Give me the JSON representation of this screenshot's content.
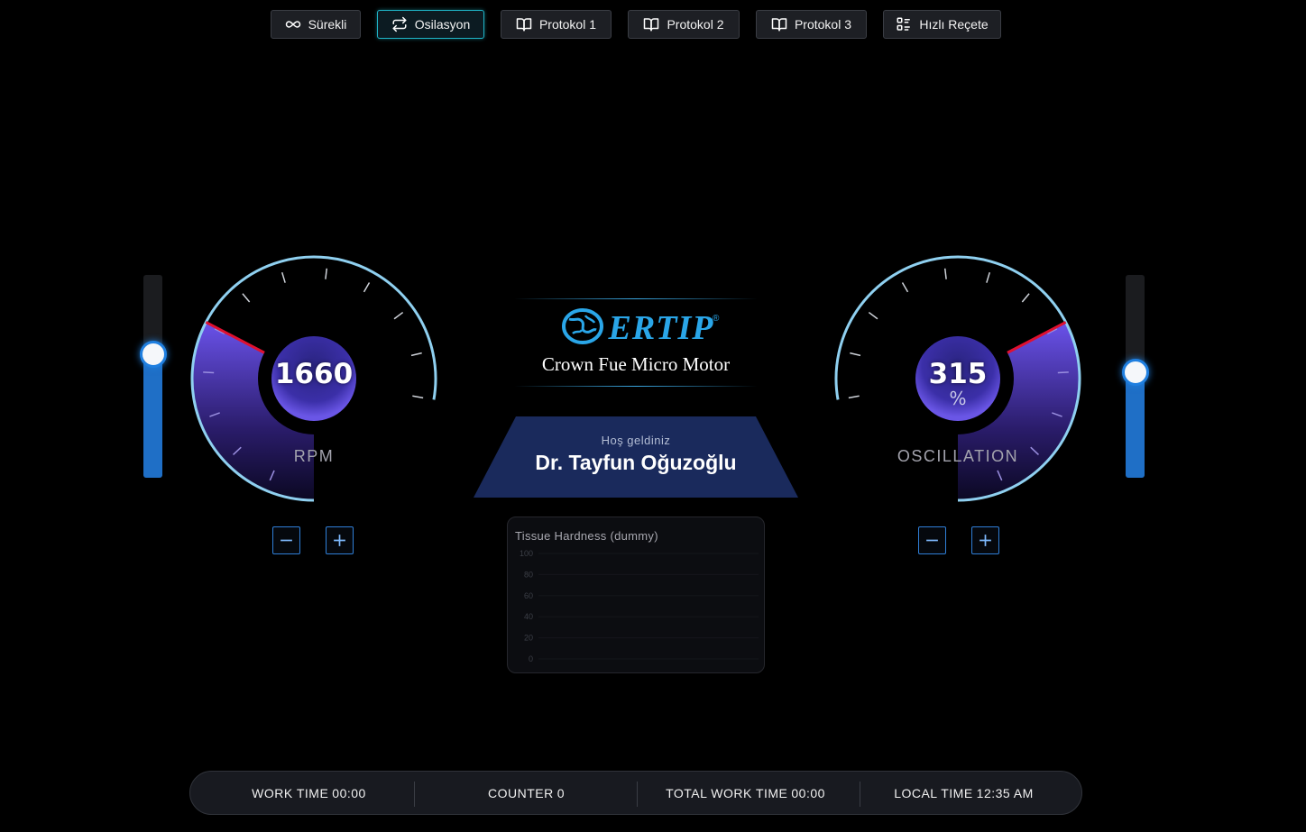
{
  "modes": [
    {
      "label": "Sürekli",
      "icon": "infinity-icon",
      "active": false
    },
    {
      "label": "Osilasyon",
      "icon": "repeat-icon",
      "active": true
    },
    {
      "label": "Protokol 1",
      "icon": "book-icon",
      "active": false
    },
    {
      "label": "Protokol 2",
      "icon": "book-icon",
      "active": false
    },
    {
      "label": "Protokol 3",
      "icon": "book-icon",
      "active": false
    },
    {
      "label": "Hızlı Reçete",
      "icon": "list-icon",
      "active": false
    }
  ],
  "rpm": {
    "value": "1660",
    "label": "RPM",
    "level": 0.42,
    "slider_level": 0.61
  },
  "oscillation": {
    "value": "315",
    "unit": "%",
    "label": "OSCILLATION",
    "level": 0.42,
    "slider_level": 0.52
  },
  "logo": {
    "brand": "ERTIP",
    "registered": "®",
    "subtitle": "Crown Fue Micro Motor"
  },
  "welcome": {
    "greeting": "Hoş geldiniz",
    "name": "Dr. Tayfun Oğuzoğlu"
  },
  "chart_data": {
    "type": "line",
    "title": "Tissue Hardness (dummy)",
    "xlabel": "",
    "ylabel": "",
    "ylim": [
      0,
      100
    ],
    "yticks": [
      "100",
      "80",
      "60",
      "40",
      "20",
      "0"
    ],
    "series": []
  },
  "footer": {
    "work_time": {
      "label": "WORK TIME",
      "value": "00:00"
    },
    "counter": {
      "label": "COUNTER",
      "value": "0"
    },
    "total_work_time": {
      "label": "TOTAL WORK TIME",
      "value": "00:00"
    },
    "local_time": {
      "label": "LOCAL TIME",
      "value": "12:35 AM"
    }
  },
  "colors": {
    "accent": "#1fb5c8",
    "gauge_fill": "#6a4fe0",
    "gauge_arc": "#8fd0f0",
    "needle": "#e01030",
    "slider_fill": "#1f6fc6",
    "panel_navy": "#1a2a5c"
  }
}
